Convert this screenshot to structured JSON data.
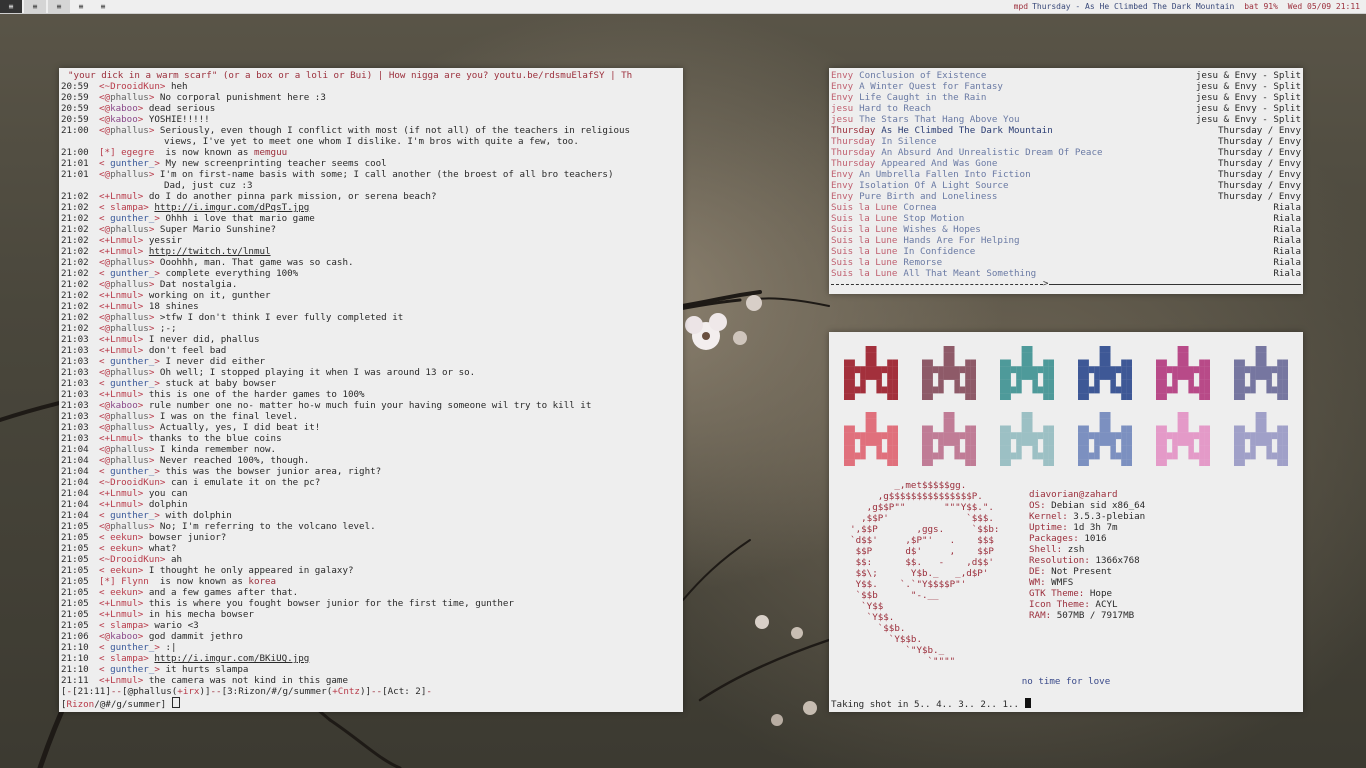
{
  "topbar": {
    "workspaces": [
      {
        "label": "≡",
        "state": "active"
      },
      {
        "label": "≡",
        "state": "lit"
      },
      {
        "label": "≡",
        "state": "lit"
      },
      {
        "label": "≡",
        "state": "normal"
      },
      {
        "label": "≡",
        "state": "normal"
      }
    ],
    "mpd_label": "mpd",
    "mpd_song": "Thursday - As He Climbed The Dark Mountain",
    "battery": "bat 91%",
    "clock": "Wed 05/09 21:11"
  },
  "irc": {
    "topic": "\"your dick in a warm scarf\" (or a box or a loli or Bui) | How nigga are you? youtu.be/rdsmuElafSY | Th",
    "lines": [
      {
        "ts": "20:59",
        "prefix": "<~",
        "nick": "DrooidKun",
        "nick_color": "c-red",
        "suffix": ">",
        "msg": "heh"
      },
      {
        "ts": "20:59",
        "prefix": "<@",
        "nick": "phallus",
        "nick_color": "c-op",
        "suffix": ">",
        "msg": "No corporal punishment here :3"
      },
      {
        "ts": "20:59",
        "prefix": "<@",
        "nick": "kaboo",
        "nick_color": "c-purple",
        "suffix": ">",
        "msg": "dead serious"
      },
      {
        "ts": "20:59",
        "prefix": "<@",
        "nick": "kaboo",
        "nick_color": "c-purple",
        "suffix": ">",
        "msg": "YOSHIE!!!!!"
      },
      {
        "ts": "21:00",
        "prefix": "<@",
        "nick": "phallus",
        "nick_color": "c-op",
        "suffix": ">",
        "msg": "Seriously, even though I conflict with most (if not all) of the teachers in religious"
      },
      {
        "ts": "",
        "cont": true,
        "msg": "views, I've yet to meet one whom I dislike. I'm bros with quite a few, too."
      },
      {
        "ts": "21:00",
        "prefix": "[*] ",
        "nick": "egegre",
        "nick_color": "c-red",
        "suffix": "",
        "msg": " is now known as ",
        "join2": "memguu"
      },
      {
        "ts": "21:01",
        "prefix": "< ",
        "nick": "gunther_",
        "nick_color": "c-blue",
        "suffix": ">",
        "msg": "My new screenprinting teacher seems cool"
      },
      {
        "ts": "21:01",
        "prefix": "<@",
        "nick": "phallus",
        "nick_color": "c-op",
        "suffix": ">",
        "msg": "I'm on first-name basis with some; I call another (the broest of all bro teachers)"
      },
      {
        "ts": "",
        "cont": true,
        "msg": "Dad, just cuz :3"
      },
      {
        "ts": "21:02",
        "prefix": "<+",
        "nick": "Lnmul",
        "nick_color": "c-red",
        "suffix": ">",
        "msg": "do I do another pinna park mission, or serena beach?"
      },
      {
        "ts": "21:02",
        "prefix": "< ",
        "nick": "slampa",
        "nick_color": "c-red",
        "suffix": ">",
        "msg": "http://i.imgur.com/dPqsT.jpg",
        "link": true
      },
      {
        "ts": "21:02",
        "prefix": "< ",
        "nick": "gunther_",
        "nick_color": "c-blue",
        "suffix": ">",
        "msg": "Ohhh i love that mario game"
      },
      {
        "ts": "21:02",
        "prefix": "<@",
        "nick": "phallus",
        "nick_color": "c-op",
        "suffix": ">",
        "msg": "Super Mario Sunshine?"
      },
      {
        "ts": "21:02",
        "prefix": "<+",
        "nick": "Lnmul",
        "nick_color": "c-red",
        "suffix": ">",
        "msg": "yessir"
      },
      {
        "ts": "21:02",
        "prefix": "<+",
        "nick": "Lnmul",
        "nick_color": "c-red",
        "suffix": ">",
        "msg": "http://twitch.tv/lnmul",
        "link": true
      },
      {
        "ts": "21:02",
        "prefix": "<@",
        "nick": "phallus",
        "nick_color": "c-op",
        "suffix": ">",
        "msg": "Ooohhh, man. That game was so cash."
      },
      {
        "ts": "21:02",
        "prefix": "< ",
        "nick": "gunther_",
        "nick_color": "c-blue",
        "suffix": ">",
        "msg": "complete everything 100%"
      },
      {
        "ts": "21:02",
        "prefix": "<@",
        "nick": "phallus",
        "nick_color": "c-op",
        "suffix": ">",
        "msg": "Dat nostalgia."
      },
      {
        "ts": "21:02",
        "prefix": "<+",
        "nick": "Lnmul",
        "nick_color": "c-red",
        "suffix": ">",
        "msg": "working on it, gunther"
      },
      {
        "ts": "21:02",
        "prefix": "<+",
        "nick": "Lnmul",
        "nick_color": "c-red",
        "suffix": ">",
        "msg": "18 shines"
      },
      {
        "ts": "21:02",
        "prefix": "<@",
        "nick": "phallus",
        "nick_color": "c-op",
        "suffix": ">",
        "msg": ">tfw I don't think I ever fully completed it"
      },
      {
        "ts": "21:02",
        "prefix": "<@",
        "nick": "phallus",
        "nick_color": "c-op",
        "suffix": ">",
        "msg": ";-;"
      },
      {
        "ts": "21:03",
        "prefix": "<+",
        "nick": "Lnmul",
        "nick_color": "c-red",
        "suffix": ">",
        "msg": "I never did, phallus"
      },
      {
        "ts": "21:03",
        "prefix": "<+",
        "nick": "Lnmul",
        "nick_color": "c-red",
        "suffix": ">",
        "msg": "don't feel bad"
      },
      {
        "ts": "21:03",
        "prefix": "< ",
        "nick": "gunther_",
        "nick_color": "c-blue",
        "suffix": ">",
        "msg": "I never did either"
      },
      {
        "ts": "21:03",
        "prefix": "<@",
        "nick": "phallus",
        "nick_color": "c-op",
        "suffix": ">",
        "msg": "Oh well; I stopped playing it when I was around 13 or so."
      },
      {
        "ts": "21:03",
        "prefix": "< ",
        "nick": "gunther_",
        "nick_color": "c-blue",
        "suffix": ">",
        "msg": "stuck at baby bowser"
      },
      {
        "ts": "21:03",
        "prefix": "<+",
        "nick": "Lnmul",
        "nick_color": "c-red",
        "suffix": ">",
        "msg": "this is one of the harder games to 100%"
      },
      {
        "ts": "21:03",
        "prefix": "<@",
        "nick": "kaboo",
        "nick_color": "c-purple",
        "suffix": ">",
        "msg": "rule number one no- matter ho-w much fuin your having someone wil try to kill it"
      },
      {
        "ts": "21:03",
        "prefix": "<@",
        "nick": "phallus",
        "nick_color": "c-op",
        "suffix": ">",
        "msg": "I was on the final level."
      },
      {
        "ts": "21:03",
        "prefix": "<@",
        "nick": "phallus",
        "nick_color": "c-op",
        "suffix": ">",
        "msg": "Actually, yes, I did beat it!"
      },
      {
        "ts": "21:03",
        "prefix": "<+",
        "nick": "Lnmul",
        "nick_color": "c-red",
        "suffix": ">",
        "msg": "thanks to the blue coins"
      },
      {
        "ts": "21:04",
        "prefix": "<@",
        "nick": "phallus",
        "nick_color": "c-op",
        "suffix": ">",
        "msg": "I kinda remember now."
      },
      {
        "ts": "21:04",
        "prefix": "<@",
        "nick": "phallus",
        "nick_color": "c-op",
        "suffix": ">",
        "msg": "Never reached 100%, though."
      },
      {
        "ts": "21:04",
        "prefix": "< ",
        "nick": "gunther_",
        "nick_color": "c-blue",
        "suffix": ">",
        "msg": "this was the bowser junior area, right?"
      },
      {
        "ts": "21:04",
        "prefix": "<~",
        "nick": "DrooidKun",
        "nick_color": "c-red",
        "suffix": ">",
        "msg": "can i emulate it on the pc?"
      },
      {
        "ts": "21:04",
        "prefix": "<+",
        "nick": "Lnmul",
        "nick_color": "c-red",
        "suffix": ">",
        "msg": "you can"
      },
      {
        "ts": "21:04",
        "prefix": "<+",
        "nick": "Lnmul",
        "nick_color": "c-red",
        "suffix": ">",
        "msg": "dolphin"
      },
      {
        "ts": "21:04",
        "prefix": "< ",
        "nick": "gunther_",
        "nick_color": "c-blue",
        "suffix": ">",
        "msg": "with dolphin"
      },
      {
        "ts": "21:05",
        "prefix": "<@",
        "nick": "phallus",
        "nick_color": "c-op",
        "suffix": ">",
        "msg": "No; I'm referring to the volcano level."
      },
      {
        "ts": "21:05",
        "prefix": "< ",
        "nick": "eekun",
        "nick_color": "c-red",
        "suffix": ">",
        "msg": "bowser junior?"
      },
      {
        "ts": "21:05",
        "prefix": "< ",
        "nick": "eekun",
        "nick_color": "c-red",
        "suffix": ">",
        "msg": "what?"
      },
      {
        "ts": "21:05",
        "prefix": "<~",
        "nick": "DrooidKun",
        "nick_color": "c-red",
        "suffix": ">",
        "msg": "ah"
      },
      {
        "ts": "21:05",
        "prefix": "< ",
        "nick": "eekun",
        "nick_color": "c-red",
        "suffix": ">",
        "msg": "I thought he only appeared in galaxy?"
      },
      {
        "ts": "21:05",
        "prefix": "[*] ",
        "nick": "Flynn",
        "nick_color": "c-red",
        "suffix": "",
        "msg": " is now known as ",
        "join2": "korea"
      },
      {
        "ts": "21:05",
        "prefix": "< ",
        "nick": "eekun",
        "nick_color": "c-red",
        "suffix": ">",
        "msg": "and a few games after that."
      },
      {
        "ts": "21:05",
        "prefix": "<+",
        "nick": "Lnmul",
        "nick_color": "c-red",
        "suffix": ">",
        "msg": "this is where you fought bowser junior for the first time, gunther"
      },
      {
        "ts": "21:05",
        "prefix": "<+",
        "nick": "Lnmul",
        "nick_color": "c-red",
        "suffix": ">",
        "msg": "in his mecha bowser"
      },
      {
        "ts": "21:05",
        "prefix": "< ",
        "nick": "slampa",
        "nick_color": "c-red",
        "suffix": ">",
        "msg": "wario <3"
      },
      {
        "ts": "21:06",
        "prefix": "<@",
        "nick": "kaboo",
        "nick_color": "c-purple",
        "suffix": ">",
        "msg": "god dammit jethro"
      },
      {
        "ts": "21:10",
        "prefix": "< ",
        "nick": "gunther_",
        "nick_color": "c-blue",
        "suffix": ">",
        "msg": ":|"
      },
      {
        "ts": "21:10",
        "prefix": "< ",
        "nick": "slampa",
        "nick_color": "c-red",
        "suffix": ">",
        "msg": "http://i.imgur.com/BKiUQ.jpg",
        "link": true
      },
      {
        "ts": "21:10",
        "prefix": "< ",
        "nick": "gunther_",
        "nick_color": "c-blue",
        "suffix": ">",
        "msg": "it hurts slampa"
      },
      {
        "ts": "21:11",
        "prefix": "<+",
        "nick": "Lnmul",
        "nick_color": "c-red",
        "suffix": ">",
        "msg": "the camera was not kind in this game"
      }
    ],
    "status": {
      "time": "21:11",
      "nick": "@phallus",
      "mode": "+irx",
      "window": "3:Rizon/#/g/summer",
      "chanmode": "+Cntz",
      "act": "Act: 2"
    },
    "input_prompt_network": "Rizon",
    "input_prompt_channel": "/@#/g/summer"
  },
  "mpd": {
    "playlist": [
      {
        "artist": "Envy",
        "title": "Conclusion of Existence",
        "album": "jesu & Envy - Split"
      },
      {
        "artist": "Envy",
        "title": "A Winter Quest for Fantasy",
        "album": "jesu & Envy - Split"
      },
      {
        "artist": "Envy",
        "title": "Life Caught in the Rain",
        "album": "jesu & Envy - Split"
      },
      {
        "artist": "jesu",
        "title": "Hard to Reach",
        "album": "jesu & Envy - Split"
      },
      {
        "artist": "jesu",
        "title": "The Stars That Hang Above You",
        "album": "jesu & Envy - Split"
      },
      {
        "artist": "Thursday",
        "title": "As He Climbed The Dark Mountain",
        "album": "Thursday / Envy",
        "current": true
      },
      {
        "artist": "Thursday",
        "title": "In Silence",
        "album": "Thursday / Envy"
      },
      {
        "artist": "Thursday",
        "title": "An Absurd And Unrealistic Dream Of Peace",
        "album": "Thursday / Envy"
      },
      {
        "artist": "Thursday",
        "title": "Appeared And Was Gone",
        "album": "Thursday / Envy"
      },
      {
        "artist": "Envy",
        "title": "An Umbrella Fallen Into Fiction",
        "album": "Thursday / Envy"
      },
      {
        "artist": "Envy",
        "title": "Isolation Of A Light Source",
        "album": "Thursday / Envy"
      },
      {
        "artist": "Envy",
        "title": "Pure Birth and Loneliness",
        "album": "Thursday / Envy"
      },
      {
        "artist": "Suis la Lune",
        "title": "Cornea",
        "album": "Riala"
      },
      {
        "artist": "Suis la Lune",
        "title": "Stop Motion",
        "album": "Riala"
      },
      {
        "artist": "Suis la Lune",
        "title": "Wishes & Hopes",
        "album": "Riala"
      },
      {
        "artist": "Suis la Lune",
        "title": "Hands Are For Helping",
        "album": "Riala"
      },
      {
        "artist": "Suis la Lune",
        "title": "In Confidence",
        "album": "Riala"
      },
      {
        "artist": "Suis la Lune",
        "title": "Remorse",
        "album": "Riala"
      },
      {
        "artist": "Suis la Lune",
        "title": "All That Meant Something",
        "album": "Riala"
      }
    ],
    "progress": 0.45
  },
  "fetch": {
    "invader_colors_row1": [
      "#a3303c",
      "#8e5a68",
      "#4e9a9a",
      "#3e5896",
      "#b84a88",
      "#7676a0"
    ],
    "invader_colors_row2": [
      "#e0707c",
      "#c07c96",
      "#9cc0c4",
      "#7c90c0",
      "#e49ac8",
      "#a0a0c8"
    ],
    "logo_lines": [
      "          _,met$$$$$gg.",
      "       ,g$$$$$$$$$$$$$$$P.",
      "     ,g$$P\"\"       \"\"\"Y$$.\".",
      "    ,$$P'              `$$$.",
      "  ',$$P       ,ggs.     `$$b:",
      "  `d$$'     ,$P\"'   .    $$$",
      "   $$P      d$'     ,    $$P",
      "   $$:      $$.   -    ,d$$'",
      "   $$\\;      Y$b._   _,d$P'",
      "   Y$$.    `.`\"Y$$$$P\"'",
      "   `$$b      \"-.__",
      "    `Y$$",
      "     `Y$$.",
      "       `$$b.",
      "         `Y$$b.",
      "            `\"Y$b._",
      "                `\"\"\"\""
    ],
    "user": "diavorian@zahard",
    "info": [
      {
        "key": "OS:",
        "val": "Debian sid x86_64"
      },
      {
        "key": "Kernel:",
        "val": "3.5.3-plebian"
      },
      {
        "key": "Uptime:",
        "val": "1d 3h 7m"
      },
      {
        "key": "Packages:",
        "val": "1016"
      },
      {
        "key": "Shell:",
        "val": "zsh"
      },
      {
        "key": "Resolution:",
        "val": "1366x768"
      },
      {
        "key": "DE:",
        "val": "Not Present"
      },
      {
        "key": "WM:",
        "val": "WMFS"
      },
      {
        "key": "GTK Theme:",
        "val": "Hope"
      },
      {
        "key": "Icon Theme:",
        "val": "ACYL"
      },
      {
        "key": "RAM:",
        "val": "507MB / 7917MB"
      }
    ],
    "motto": "no time for love",
    "shot_text": "Taking shot in 5.. 4.. 3.. 2.. 1.. "
  }
}
